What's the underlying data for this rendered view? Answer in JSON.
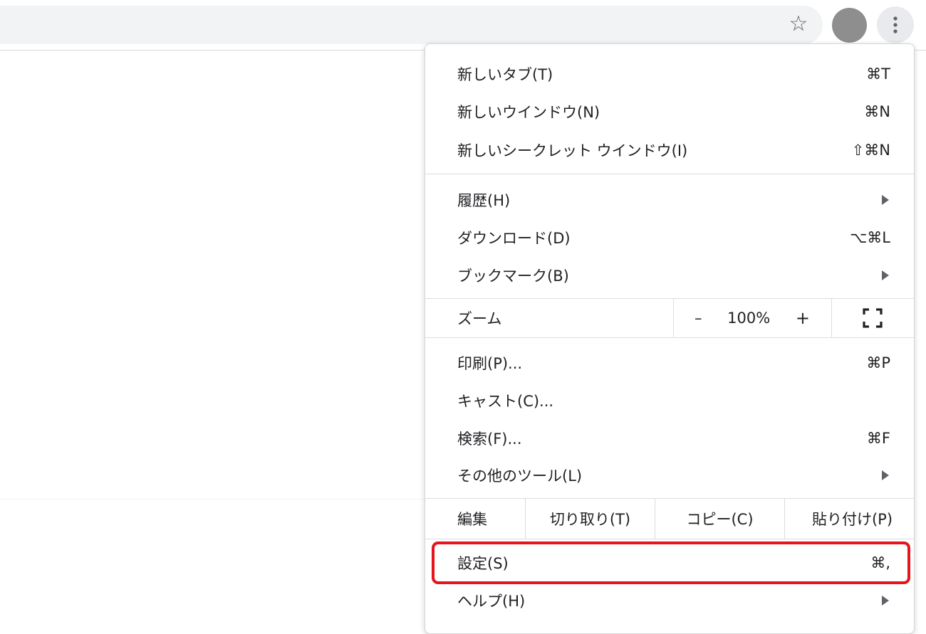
{
  "toolbar": {
    "bookmark_icon": "star-outline-icon",
    "menu_icon": "three-dots-vertical-icon"
  },
  "menu": {
    "items_group1": [
      {
        "label": "新しいタブ(T)",
        "shortcut": "⌘T"
      },
      {
        "label": "新しいウインドウ(N)",
        "shortcut": "⌘N"
      },
      {
        "label": "新しいシークレット ウインドウ(I)",
        "shortcut": "⇧⌘N"
      }
    ],
    "items_group2": [
      {
        "label": "履歴(H)",
        "submenu": true
      },
      {
        "label": "ダウンロード(D)",
        "shortcut": "⌥⌘L"
      },
      {
        "label": "ブックマーク(B)",
        "submenu": true
      }
    ],
    "zoom": {
      "label": "ズーム",
      "minus": "–",
      "value": "100%",
      "plus": "+",
      "fullscreen_icon": "fullscreen-icon"
    },
    "items_group3": [
      {
        "label": "印刷(P)...",
        "shortcut": "⌘P"
      },
      {
        "label": "キャスト(C)..."
      },
      {
        "label": "検索(F)...",
        "shortcut": "⌘F"
      },
      {
        "label": "その他のツール(L)",
        "submenu": true
      }
    ],
    "edit": {
      "label": "編集",
      "cut": "切り取り(T)",
      "copy": "コピー(C)",
      "paste": "貼り付け(P)"
    },
    "settings": {
      "label": "設定(S)",
      "shortcut": "⌘,"
    },
    "help": {
      "label": "ヘルプ(H)",
      "submenu": true
    }
  },
  "colors": {
    "highlight": "#e6141c",
    "avatar": "#8e8e8e",
    "omnibox": "#f1f3f4"
  }
}
